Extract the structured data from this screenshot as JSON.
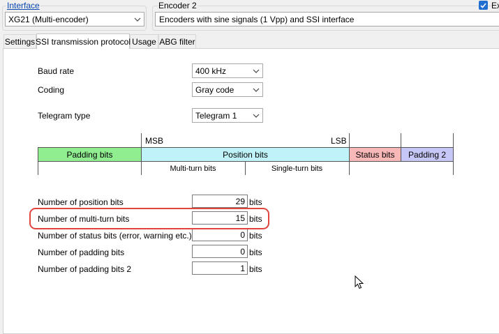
{
  "interface": {
    "label": "Interface",
    "selected": "XG21 (Multi-encoder)"
  },
  "encoder": {
    "label": "Encoder 2",
    "description": "Encoders with sine signals (1 Vpp) and SSI interface",
    "checkbox_label": "Ex"
  },
  "tabs": [
    {
      "label": "Settings"
    },
    {
      "label": "SSI transmission protocol"
    },
    {
      "label": "Usage"
    },
    {
      "label": "ABG filter"
    }
  ],
  "ssi": {
    "baud_rate": {
      "label": "Baud rate",
      "value": "400 kHz"
    },
    "coding": {
      "label": "Coding",
      "value": "Gray code"
    },
    "telegram_type": {
      "label": "Telegram type",
      "value": "Telegram 1"
    }
  },
  "telegram_table": {
    "msb": "MSB",
    "lsb": "LSB",
    "padding_bits": "Padding bits",
    "position_bits": "Position bits",
    "status_bits": "Status bits",
    "padding_2": "Padding 2",
    "multi_turn_bits": "Multi-turn bits",
    "single_turn_bits": "Single-turn bits"
  },
  "bit_fields": [
    {
      "label": "Number of position bits",
      "value": "29",
      "unit": "bits"
    },
    {
      "label": "Number of multi-turn bits",
      "value": "15",
      "unit": "bits"
    },
    {
      "label": "Number of status bits (error, warning etc.)",
      "value": "0",
      "unit": "bits"
    },
    {
      "label": "Number of padding bits",
      "value": "0",
      "unit": "bits"
    },
    {
      "label": "Number of padding bits 2",
      "value": "1",
      "unit": "bits"
    }
  ],
  "colors": {
    "padding_bits": "#90ee90",
    "position_bits": "#bff3f9",
    "status_bits": "#f8b8b8",
    "padding_2": "#c7c7f7",
    "highlight": "#e0443c",
    "checkbox": "#1f6fd1"
  }
}
